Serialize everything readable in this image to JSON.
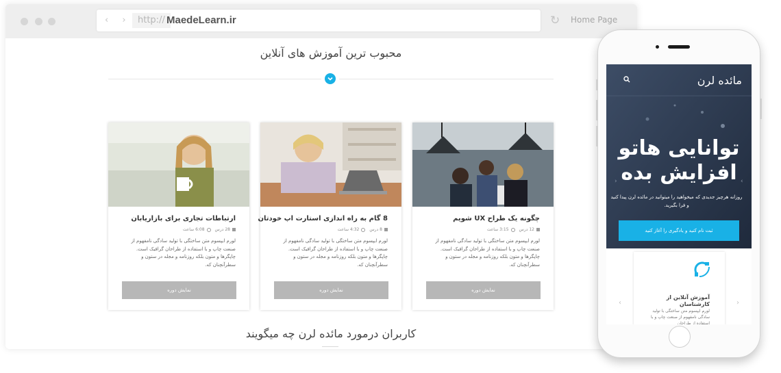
{
  "browser": {
    "nav_arrows": "‹ ›",
    "protocol": "http://",
    "domain": "MaedeLearn.ir",
    "home_label": "Home Page"
  },
  "section": {
    "popular_title": "محبوب ترین آموزش های آنلاین",
    "testimonials_title": "کاربران درمورد مائده لرن چه میگویند"
  },
  "courses": [
    {
      "title": "چگونه یک طراح UX شویم",
      "lessons": "12 درس",
      "duration": "3:15 ساعت",
      "description": "لورم ایپسوم متن ساختگی با تولید سادگی نامفهوم از صنعت چاپ و با استفاده از طراحان گرافیک است. چاپگرها و متون بلکه روزنامه و مجله در ستون و سطرآنچنان که.",
      "button": "نمایش دوره"
    },
    {
      "title": "8 گام به راه اندازی استارت اپ خودتان",
      "lessons": "8 درس",
      "duration": "4:32 ساعت",
      "description": "لورم ایپسوم متن ساختگی با تولید سادگی نامفهوم از صنعت چاپ و با استفاده از طراحان گرافیک است. چاپگرها و متون بلکه روزنامه و مجله در ستون و سطرآنچنان که.",
      "button": "نمایش دوره"
    },
    {
      "title": "ارتباطات تجاری برای بازاریابان",
      "lessons": "28 درس",
      "duration": "6:08 ساعت",
      "description": "لورم ایپسوم متن ساختگی با تولید سادگی نامفهوم از صنعت چاپ و با استفاده از طراحان گرافیک است. چاپگرها و متون بلکه روزنامه و مجله در ستون و سطرآنچنان که.",
      "button": "نمایش دوره"
    }
  ],
  "phone": {
    "brand": "مائده لرن",
    "headline_1": "توانایی هاتو",
    "headline_2": "افزایش بده",
    "tagline": "روزانه هرچیز جدیدی که میخواهید را میتوانید در مائده لرن پیدا کنید و فرا بگیرید.",
    "cta": "ثبت نام کنید و یادگیری را آغاز کنید",
    "card_title": "آموزش آنلاین از کارشناسان",
    "card_desc": "لورم ایپسوم متن ساختگی با تولید سادگی نامفهوم از صنعت چاپ و با استفاده از طراحان"
  },
  "colors": {
    "accent": "#19b1e6",
    "button_gray": "#b7b7b7",
    "hero_bg": "#2b3a51"
  }
}
